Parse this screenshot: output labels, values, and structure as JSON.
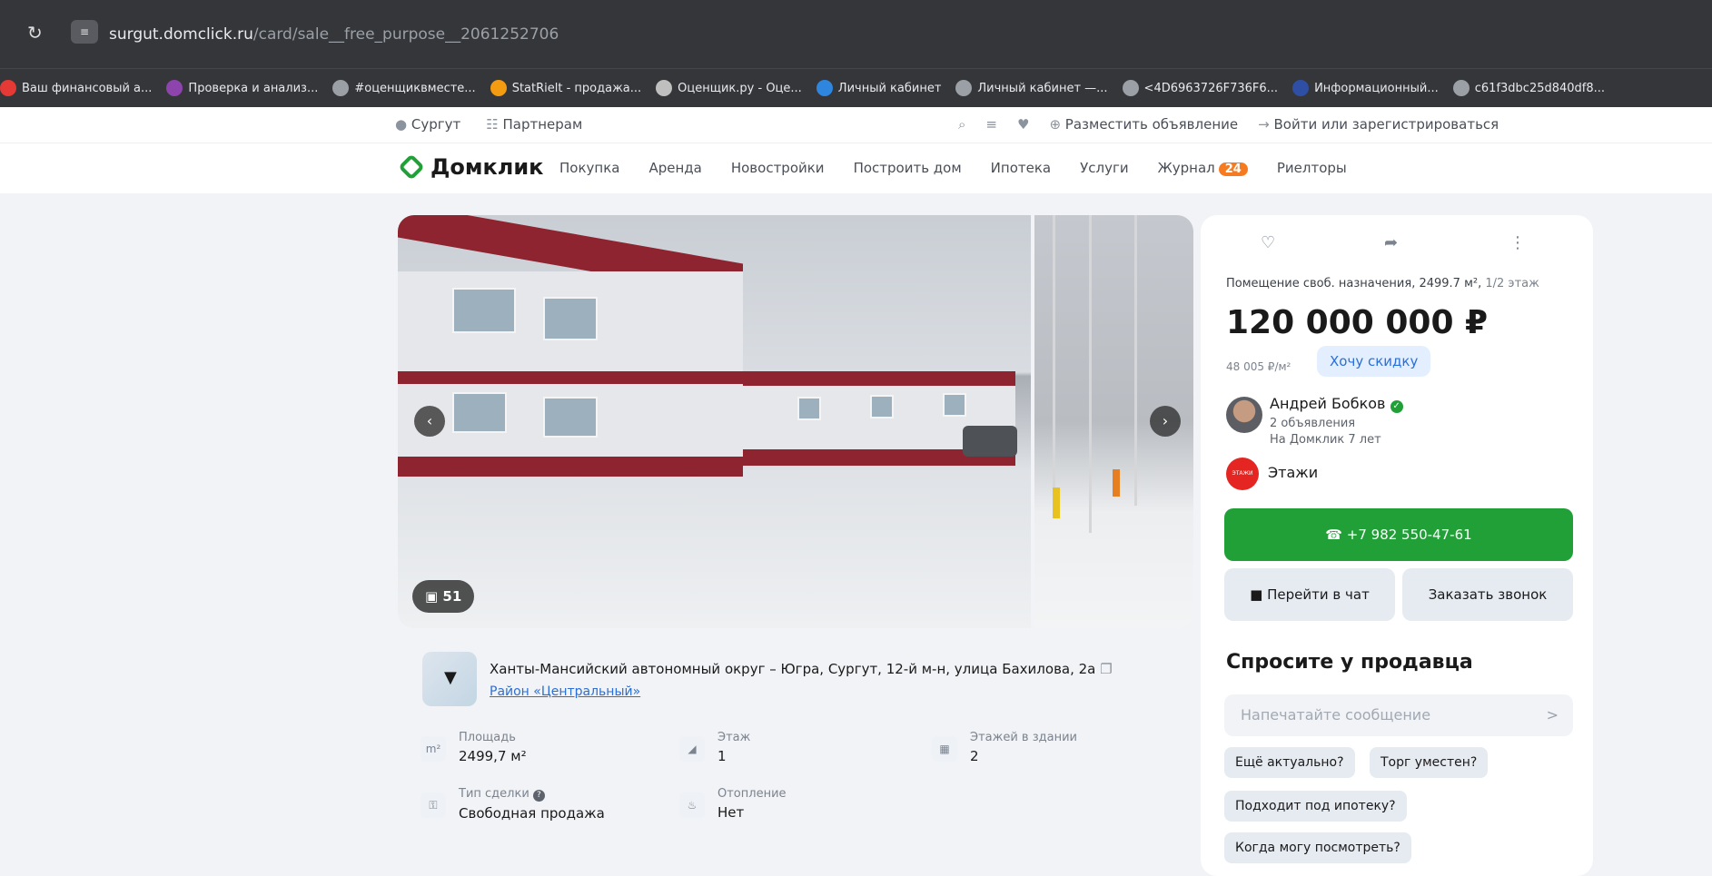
{
  "browser": {
    "url_host": "surgut.domclick.ru",
    "url_path": "/card/sale__free_purpose__2061252706",
    "bookmarks": [
      {
        "label": "Ваш финансовый а...",
        "color": "#e53935"
      },
      {
        "label": "Проверка и анализ...",
        "color": "#8e44ad"
      },
      {
        "label": "#оценщиквместе...",
        "color": "#9aa0a6"
      },
      {
        "label": "StatRielt - продажа...",
        "color": "#f39c12"
      },
      {
        "label": "Оценщик.ру - Оце...",
        "color": "#bfbfbf"
      },
      {
        "label": "Личный кабинет",
        "color": "#2e86de"
      },
      {
        "label": "Личный кабинет —...",
        "color": "#9aa0a6"
      },
      {
        "label": "<4D6963726F736F6...",
        "color": "#9aa0a6"
      },
      {
        "label": "Информационный...",
        "color": "#2e4fa3"
      },
      {
        "label": "c61f3dbc25d840df8...",
        "color": "#9aa0a6"
      }
    ]
  },
  "topline": {
    "city": "Сургут",
    "partners": "Партнерам",
    "post_ad": "Разместить объявление",
    "login": "Войти или зарегистрироваться"
  },
  "nav": {
    "logo": "Домклик",
    "items": [
      "Покупка",
      "Аренда",
      "Новостройки",
      "Построить дом",
      "Ипотека",
      "Услуги",
      "Журнал",
      "Риелторы"
    ],
    "journal_badge": "24"
  },
  "gallery": {
    "photo_count": "51"
  },
  "address": {
    "full": "Ханты-Мансийский автономный округ – Югра, Сургут, 12-й м-н, улица Бахилова, 2а",
    "district": "Район «Центральный»"
  },
  "params": [
    {
      "label": "Площадь",
      "value": "2499,7 м²"
    },
    {
      "label": "Этаж",
      "value": "1"
    },
    {
      "label": "Этажей в здании",
      "value": "2"
    },
    {
      "label": "Тип сделки",
      "value": "Свободная продажа"
    },
    {
      "label": "Отопление",
      "value": "Нет"
    }
  ],
  "panel": {
    "title": "Помещение своб. назначения, 2499.7 м²,",
    "floor": "1/2 этаж",
    "price": "120 000 000 ₽",
    "per_m2": "48 005 ₽/м²",
    "discount": "Хочу скидку",
    "agent_name": "Андрей Бобков",
    "agent_ads": "2 объявления",
    "agent_since": "На Домклик 7 лет",
    "agency": "Этажи",
    "phone": "+7 982 550-47-61",
    "chat": "Перейти в чат",
    "callback": "Заказать звонок",
    "ask_title": "Спросите у продавца",
    "msg_placeholder": "Напечатайте сообщение",
    "chips": [
      "Ещё актуально?",
      "Торг уместен?",
      "Подходит под ипотеку?",
      "Когда могу посмотреть?"
    ]
  },
  "colors": {
    "brand_green": "#21a038",
    "accent_blue": "#2b6fd6",
    "badge_orange": "#f57a20"
  }
}
